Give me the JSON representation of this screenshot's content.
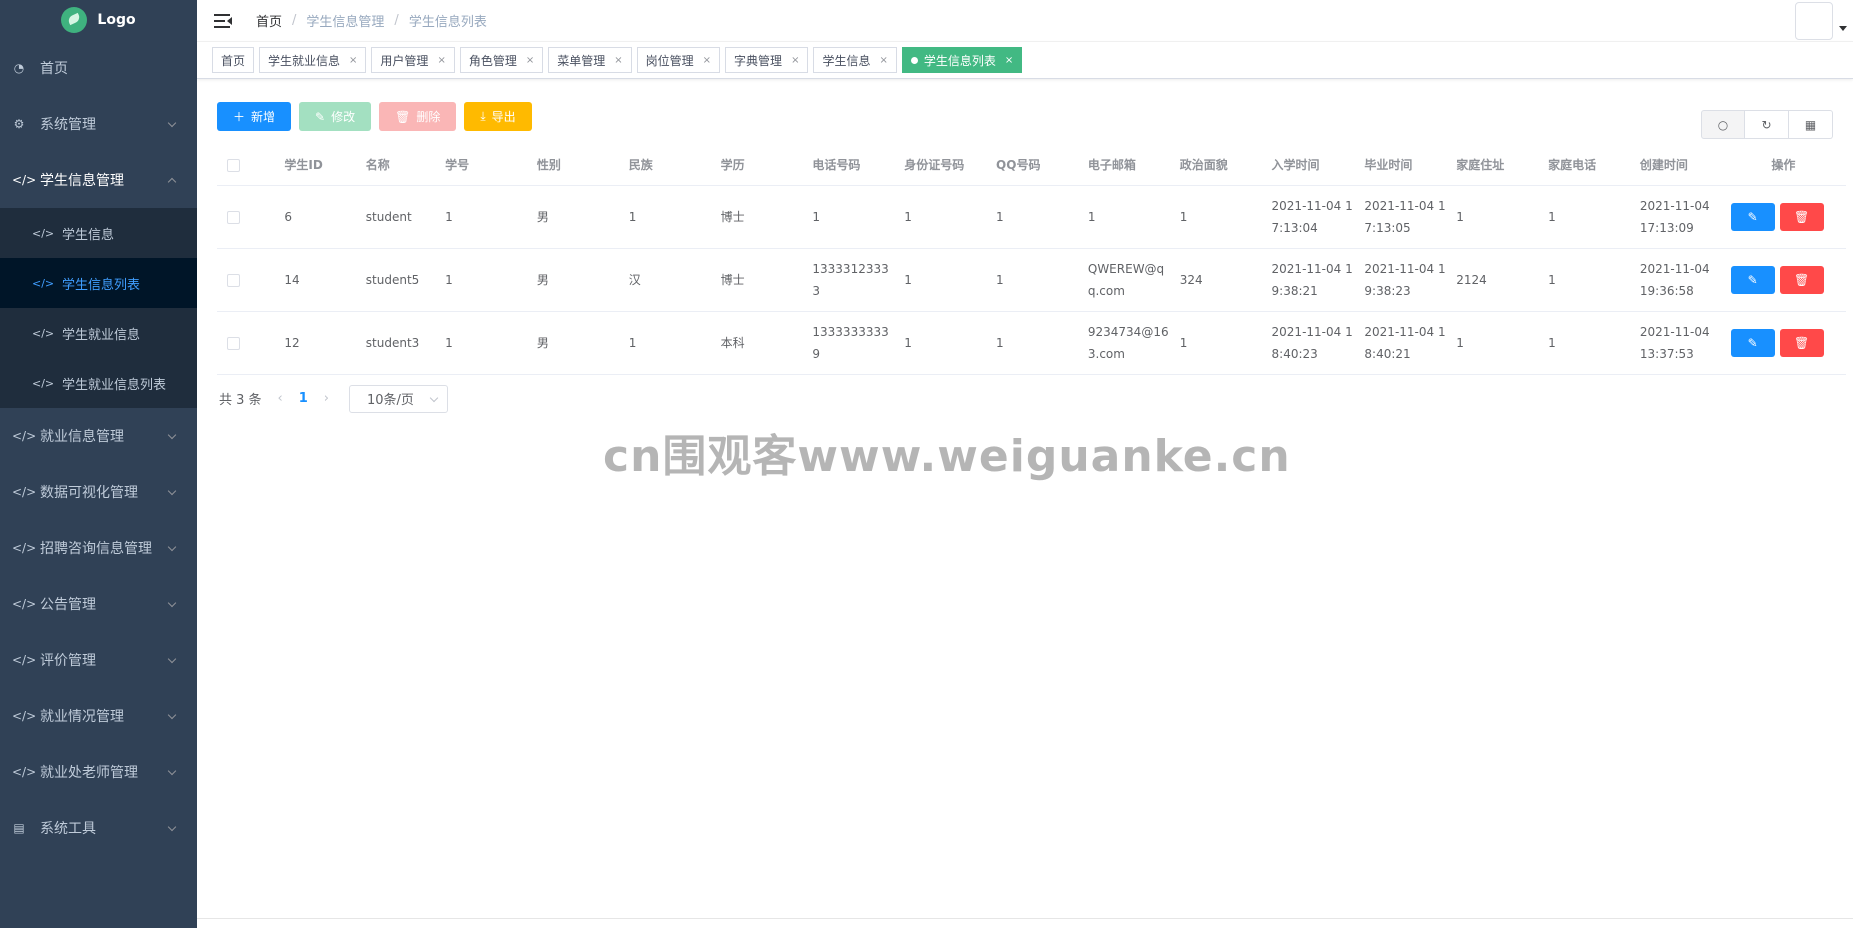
{
  "logo": {
    "text": "Logo"
  },
  "sidebar": {
    "home": "首页",
    "system_manage": "系统管理",
    "student_info_manage": "学生信息管理",
    "sub": [
      "学生信息",
      "学生信息列表",
      "学生就业信息",
      "学生就业信息列表"
    ],
    "rest": [
      "就业信息管理",
      "数据可视化管理",
      "招聘咨询信息管理",
      "公告管理",
      "评价管理",
      "就业情况管理",
      "就业处老师管理",
      "系统工具"
    ]
  },
  "breadcrumb": {
    "home": "首页",
    "level1": "学生信息管理",
    "level2": "学生信息列表",
    "sep": "/"
  },
  "tags": [
    "首页",
    "学生就业信息",
    "用户管理",
    "角色管理",
    "菜单管理",
    "岗位管理",
    "字典管理",
    "学生信息",
    "学生信息列表"
  ],
  "toolbar": {
    "add": "新增",
    "edit": "修改",
    "delete": "删除",
    "export": "导出"
  },
  "table": {
    "headers": [
      "学生ID",
      "名称",
      "学号",
      "性别",
      "民族",
      "学历",
      "电话号码",
      "身份证号码",
      "QQ号码",
      "电子邮箱",
      "政治面貌",
      "入学时间",
      "毕业时间",
      "家庭住址",
      "家庭电话",
      "创建时间",
      "操作"
    ],
    "rows": [
      [
        "6",
        "student",
        "1",
        "男",
        "1",
        "博士",
        "1",
        "1",
        "1",
        "1",
        "1",
        "2021-11-04 17:13:04",
        "2021-11-04 17:13:05",
        "1",
        "1",
        "2021-11-04 17:13:09"
      ],
      [
        "14",
        "student5",
        "1",
        "男",
        "汉",
        "博士",
        "13333123333",
        "1",
        "1",
        "QWEREW@qq.com",
        "324",
        "2021-11-04 19:38:21",
        "2021-11-04 19:38:23",
        "2124",
        "1",
        "2021-11-04 19:36:58"
      ],
      [
        "12",
        "student3",
        "1",
        "男",
        "1",
        "本科",
        "13333333339",
        "1",
        "1",
        "9234734@163.com",
        "1",
        "2021-11-04 18:40:23",
        "2021-11-04 18:40:21",
        "1",
        "1",
        "2021-11-04 13:37:53"
      ]
    ]
  },
  "pagination": {
    "total": "共 3 条",
    "current": "1",
    "page_size": "10条/页"
  },
  "watermark": "cn围观客www.weiguanke.cn",
  "icons": {
    "tag_close": "×",
    "prev": "‹",
    "next": "›"
  }
}
